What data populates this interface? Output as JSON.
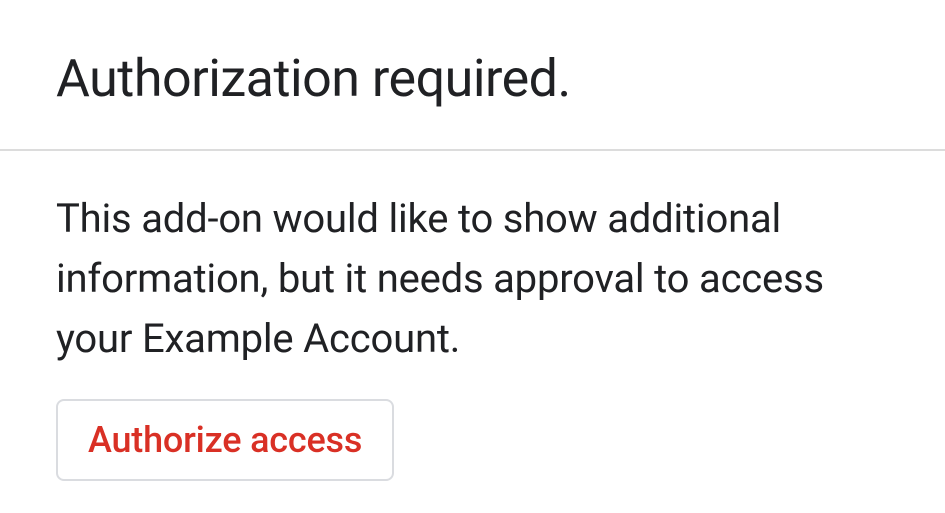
{
  "header": {
    "title": "Authorization required."
  },
  "body": {
    "description": "This add-on would like to show additional information, but it needs approval to access your Example Account."
  },
  "actions": {
    "authorize_label": "Authorize access"
  }
}
